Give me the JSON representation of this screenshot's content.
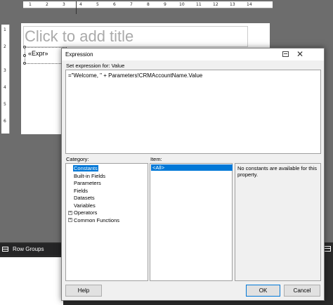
{
  "designer": {
    "ruler_ticks": [
      "1",
      "2",
      "3",
      "4",
      "5",
      "6",
      "7",
      "8",
      "9",
      "10",
      "11",
      "12",
      "13",
      "14"
    ],
    "vertical_ticks": [
      "1",
      "2",
      "3",
      "4",
      "5",
      "6"
    ],
    "report_title_placeholder": "Click to add title",
    "textbox_expression": "«Expr»",
    "row_groups_label": "Row Groups"
  },
  "dialog": {
    "title": "Expression",
    "set_expression_label": "Set expression for: Value",
    "expression_text": "=\"Welcome, \" + Parameters!CRMAccountName.Value",
    "category_label": "Category:",
    "item_label": "Item:",
    "categories": [
      {
        "label": "Constants",
        "selected": true,
        "expandable": false
      },
      {
        "label": "Built-in Fields",
        "selected": false,
        "expandable": false
      },
      {
        "label": "Parameters",
        "selected": false,
        "expandable": false
      },
      {
        "label": "Fields",
        "selected": false,
        "expandable": false
      },
      {
        "label": "Datasets",
        "selected": false,
        "expandable": false
      },
      {
        "label": "Variables",
        "selected": false,
        "expandable": false
      },
      {
        "label": "Operators",
        "selected": false,
        "expandable": true
      },
      {
        "label": "Common Functions",
        "selected": false,
        "expandable": true
      }
    ],
    "items": [
      "<All>"
    ],
    "description": "No constants are available for this property.",
    "buttons": {
      "help": "Help",
      "ok": "OK",
      "cancel": "Cancel"
    },
    "icons": {
      "pin": "pin-icon",
      "close": "close-icon",
      "close_glyph": "✕",
      "expander_glyph": "+"
    },
    "colors": {
      "selection": "#0078d7",
      "dialog_bg": "#f0f0f0"
    }
  }
}
